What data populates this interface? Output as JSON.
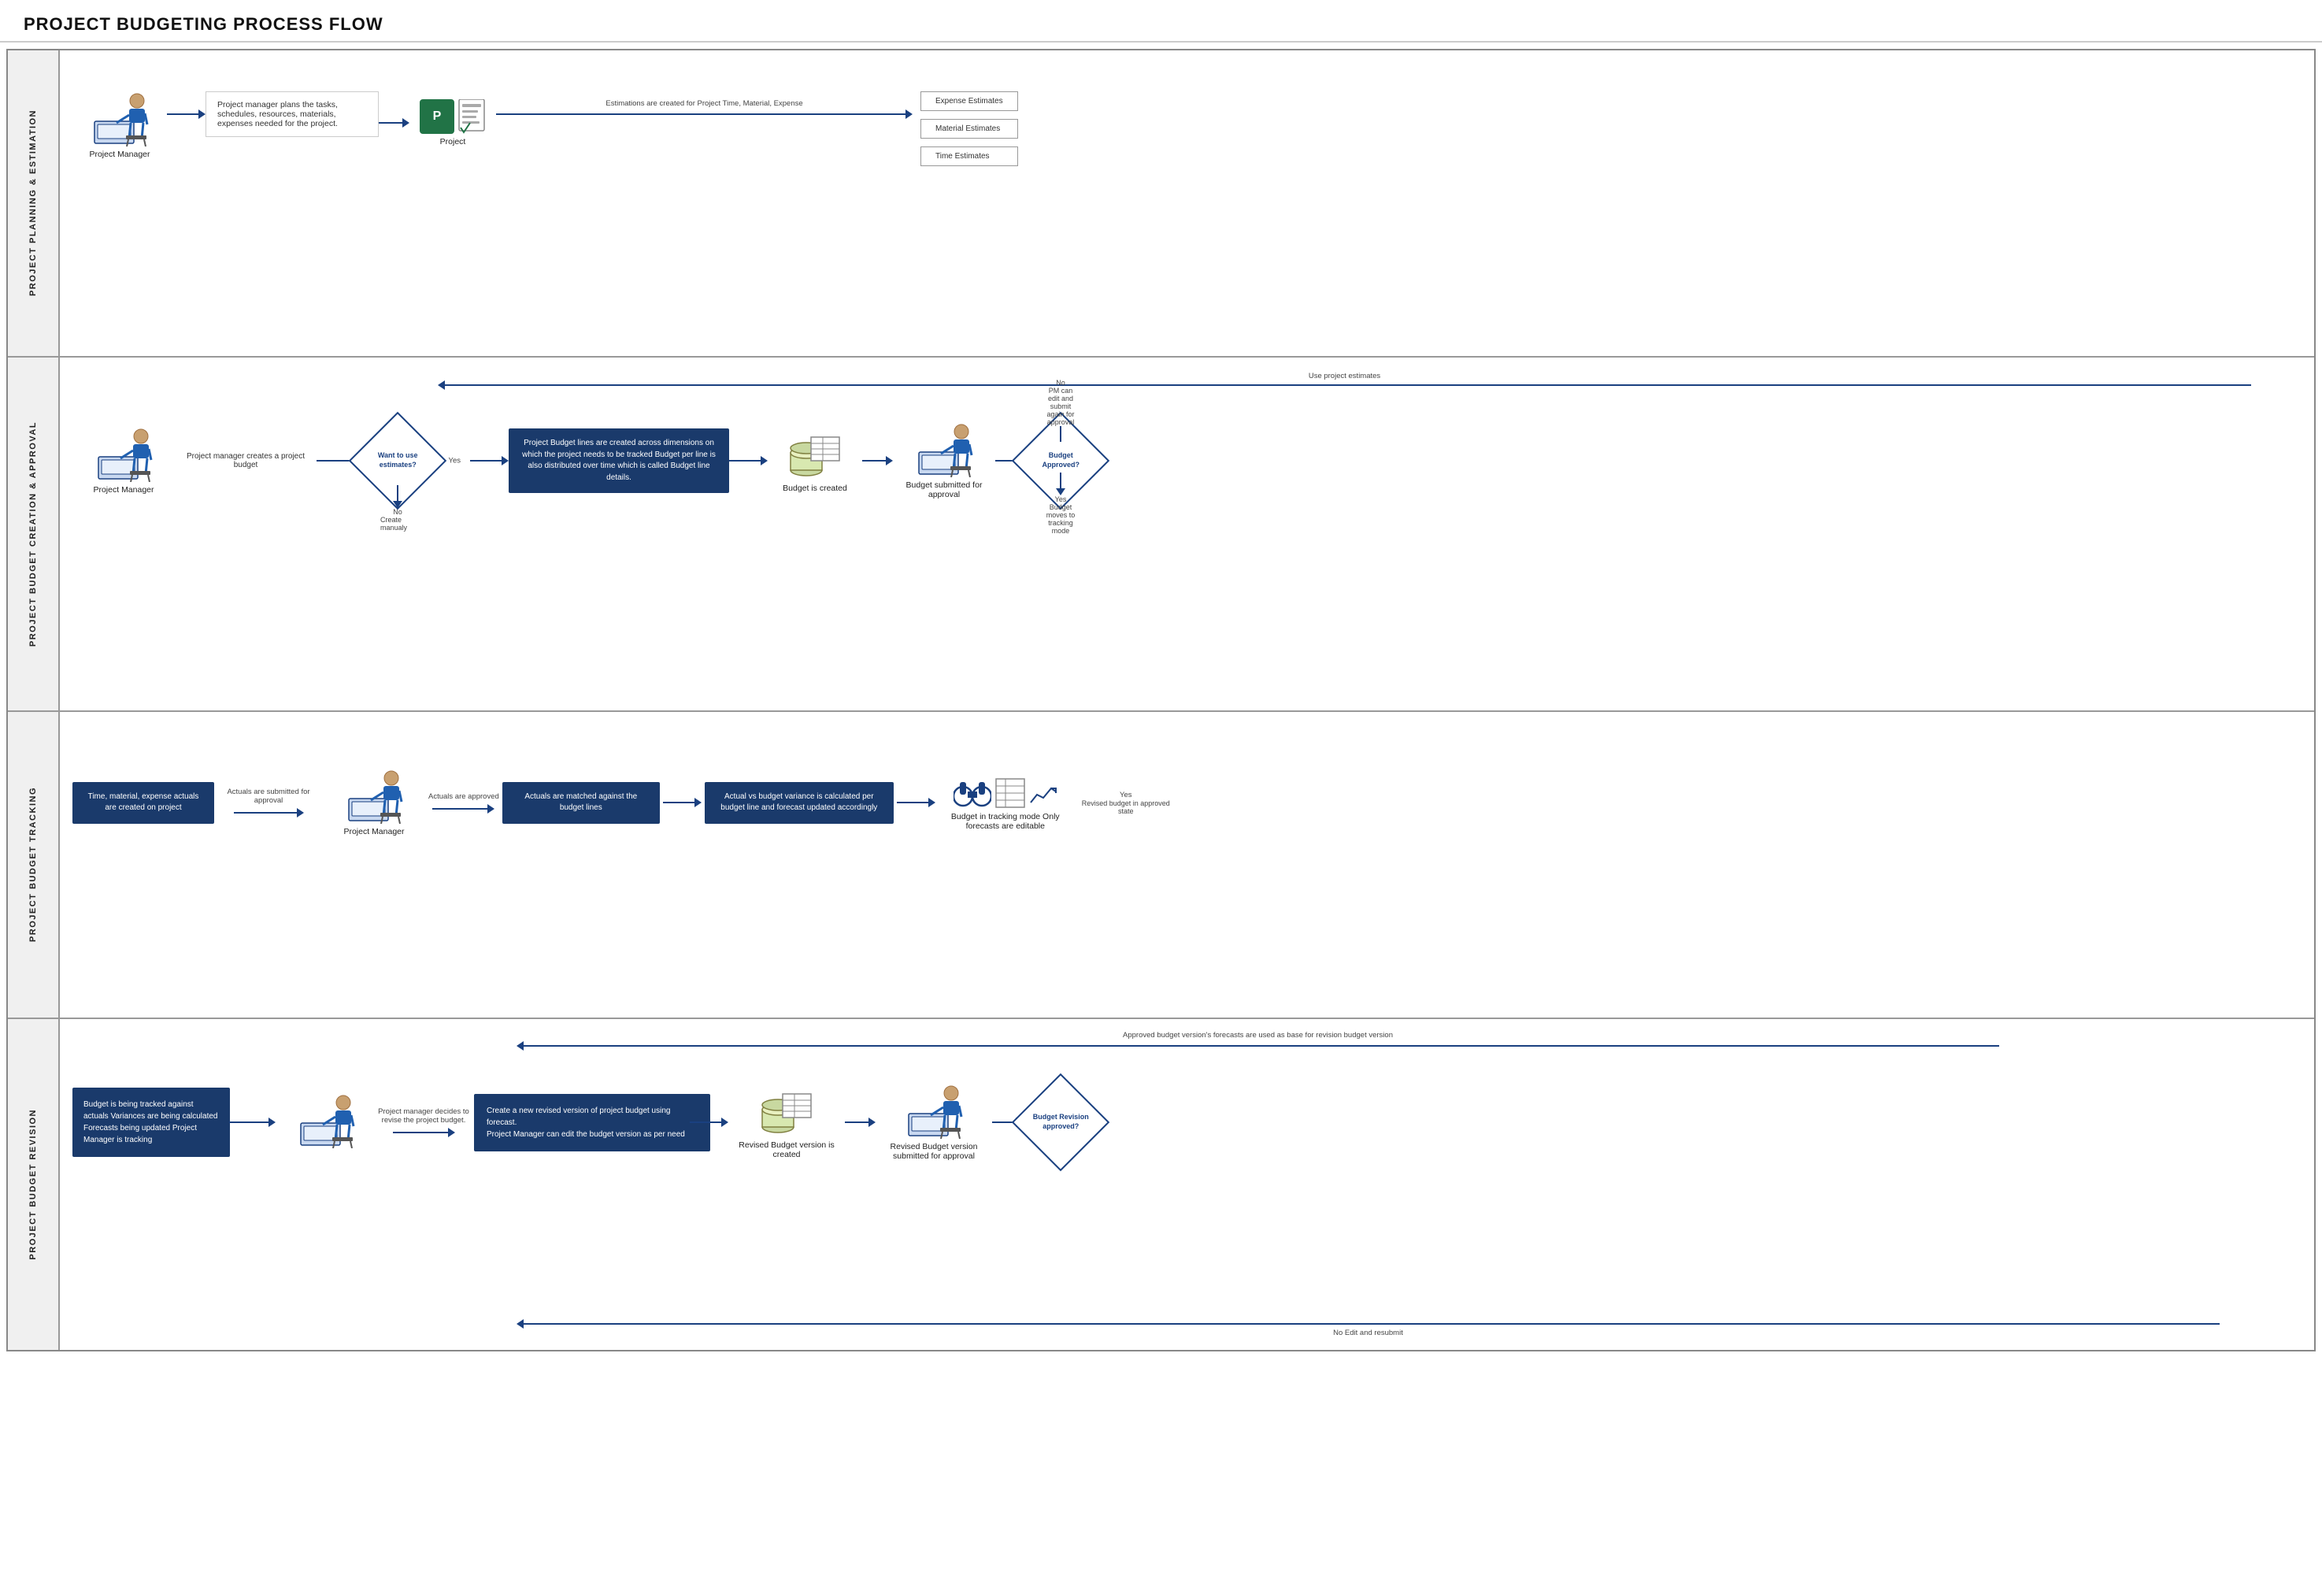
{
  "page": {
    "title": "PROJECT BUDGETING PROCESS FLOW"
  },
  "swimlanes": [
    {
      "id": "sl1",
      "label": "PROJECT PLANNING & ESTIMATION",
      "actor": "Project Manager",
      "content": {
        "step1_text": "Project manager plans the tasks, schedules, resources, materials, expenses needed for the project.",
        "project_icon_label": "Project",
        "arrow1_label": "Estimations are created for Project Time, Material, Expense",
        "estimates": [
          "Expense Estimates",
          "Material Estimates",
          "Time Estimates"
        ]
      }
    },
    {
      "id": "sl2",
      "label": "PROJECT BUDGET CREATION & APPROVAL",
      "actor": "Project Manager",
      "content": {
        "step1_text": "Project manager creates a project budget",
        "diamond1_text": "Want to use estimates?",
        "yes_label": "Yes",
        "no_label": "No",
        "no_sub": "Create manualy",
        "use_estimates_label": "Use project estimates",
        "blue_box_text": "Project Budget lines are created across dimensions on which the project needs to be tracked Budget per line is also distributed over time which is called Budget line details.",
        "budget_created_label": "Budget is created",
        "submitted_label": "Budget submitted for approval",
        "diamond2_text": "Budget Approved?",
        "yes2_label": "Yes",
        "no2_label": "No",
        "yes2_sub": "Budget moves to tracking mode",
        "no2_sub": "PM can edit and submit again for approval"
      }
    },
    {
      "id": "sl3",
      "label": "PROJECT BUDGET TRACKING",
      "content": {
        "start_box_text": "Time, material, expense actuals are created on project",
        "arrow1_label": "Actuals are submitted for approval",
        "actor": "Project Manager",
        "arrow2_label": "Actuals are approved",
        "blue_box1_text": "Actuals are matched against the budget lines",
        "blue_box2_text": "Actual vs budget variance is calculated per budget line and forecast updated accordingly",
        "tracking_label": "Budget in tracking mode Only forecasts are editable",
        "yes_label": "Yes",
        "yes_sub": "Revised budget in approved state"
      }
    },
    {
      "id": "sl4",
      "label": "PROJECT BUDGET REVISION",
      "content": {
        "start_box_text": "Budget is being tracked against actuals Variances are being calculated Forecasts being updated Project Manager is tracking",
        "actor": "Project Manager",
        "arrow1_label": "Project manager decides to revise the project budget.",
        "top_label": "Approved budget version's forecasts are used as base for revision budget version",
        "blue_box_text": "Create a new revised version of project budget using forecast.\nProject Manager can edit the budget version as per need",
        "revised_created_label": "Revised Budget version is created",
        "revised_submitted_label": "Revised Budget version submitted for approval",
        "diamond_text": "Budget Revision approved?",
        "no_label": "No Edit and resubmit"
      }
    }
  ]
}
